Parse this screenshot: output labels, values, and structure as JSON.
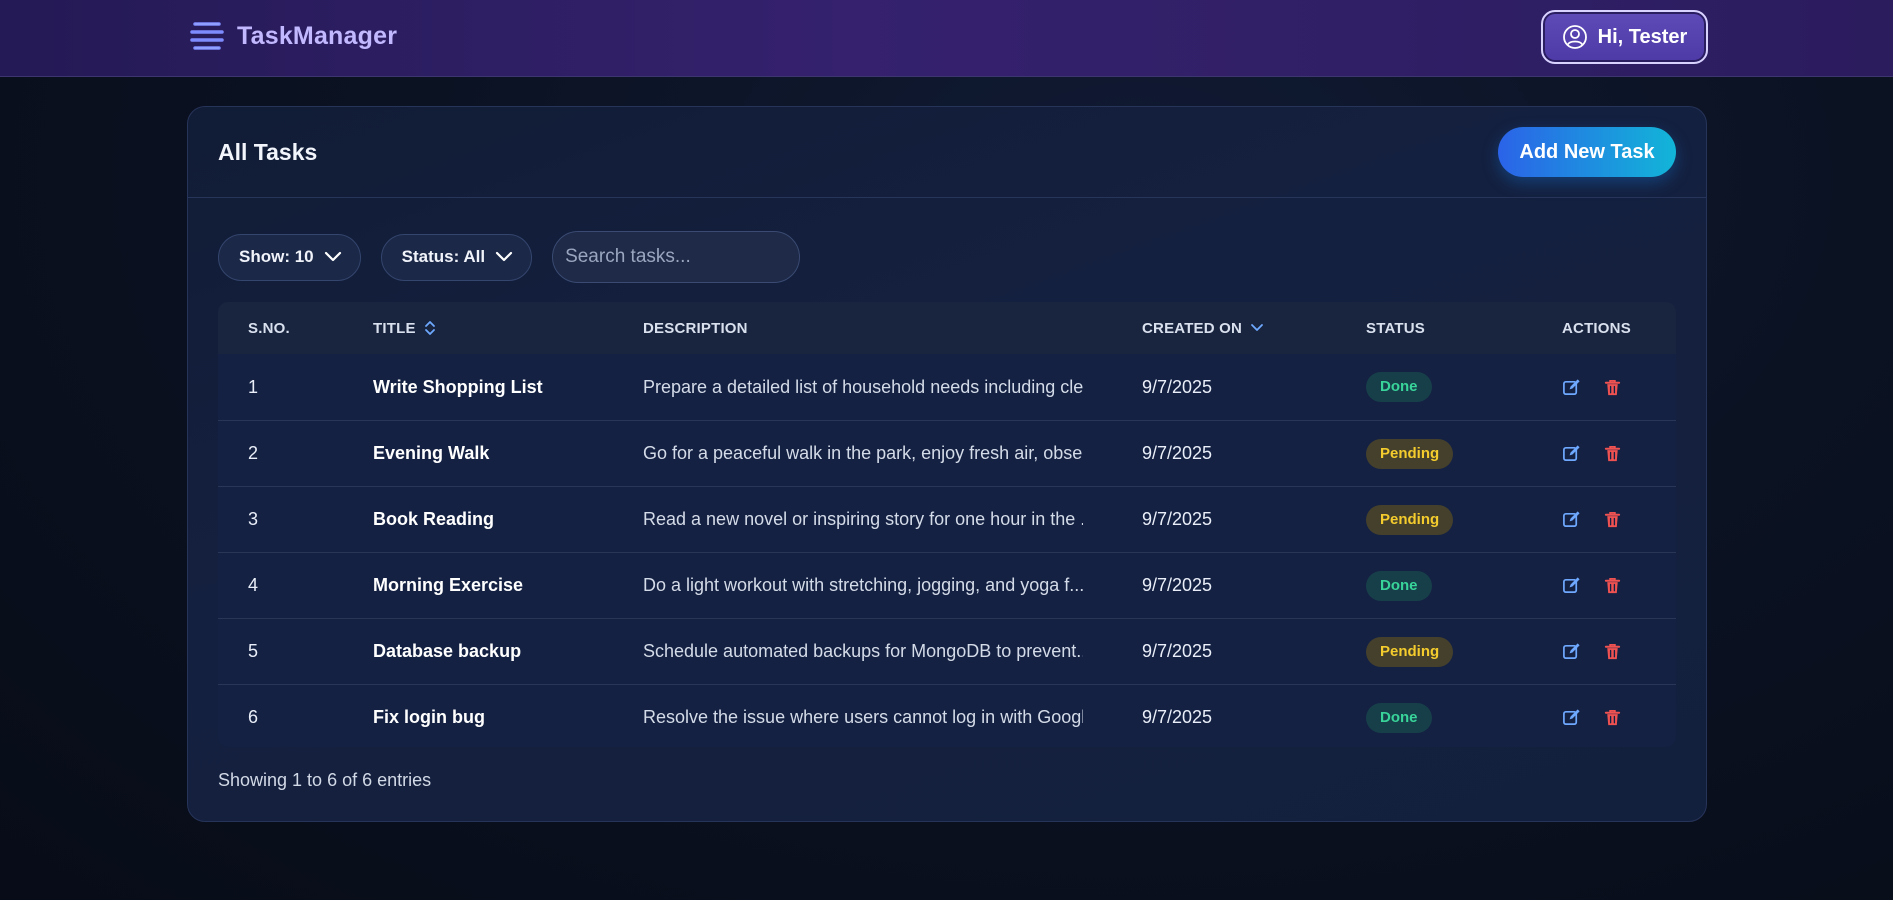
{
  "navbar": {
    "brand": "TaskManager",
    "user_label": "Hi, Tester"
  },
  "card": {
    "title": "All Tasks",
    "add_button": "Add New Task",
    "filters": {
      "show": "Show: 10",
      "status": "Status: All",
      "search_placeholder": "Search tasks..."
    },
    "columns": [
      "S.NO.",
      "TITLE",
      "DESCRIPTION",
      "CREATED ON",
      "STATUS",
      "ACTIONS"
    ],
    "rows": [
      {
        "sno": "1",
        "title": "Write Shopping List",
        "description": "Prepare a detailed list of household needs including cle...",
        "created": "9/7/2025",
        "status": "Done"
      },
      {
        "sno": "2",
        "title": "Evening Walk",
        "description": "Go for a peaceful walk in the park, enjoy fresh air, obse...",
        "created": "9/7/2025",
        "status": "Pending"
      },
      {
        "sno": "3",
        "title": "Book Reading",
        "description": "Read a new novel or inspiring story for one hour in the ...",
        "created": "9/7/2025",
        "status": "Pending"
      },
      {
        "sno": "4",
        "title": "Morning Exercise",
        "description": "Do a light workout with stretching, jogging, and yoga f...",
        "created": "9/7/2025",
        "status": "Done"
      },
      {
        "sno": "5",
        "title": "Database backup",
        "description": "Schedule automated backups for MongoDB to prevent...",
        "created": "9/7/2025",
        "status": "Pending"
      },
      {
        "sno": "6",
        "title": "Fix login bug",
        "description": "Resolve the issue where users cannot log in with Googl...",
        "created": "9/7/2025",
        "status": "Done"
      }
    ],
    "footer": "Showing 1 to 6 of 6 entries"
  },
  "colors": {
    "done": "#39d49a",
    "pending": "#f4cc2d",
    "accent": "#2b63e8",
    "delete": "#f05252",
    "edit": "#6ea8ff"
  },
  "icons": [
    "list-icon",
    "user-circle-icon",
    "chevron-down-icon",
    "sort-icon",
    "edit-icon",
    "trash-icon"
  ]
}
